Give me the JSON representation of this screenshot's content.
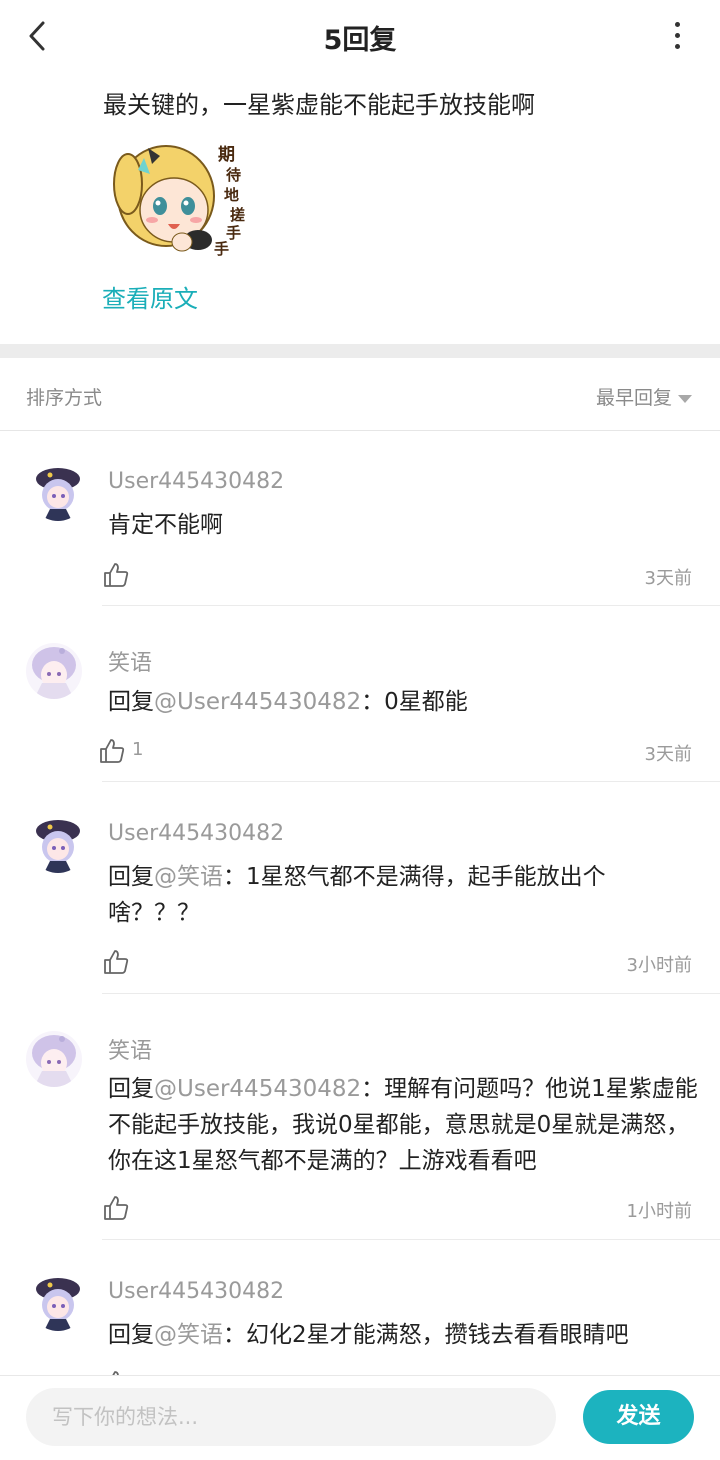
{
  "header": {
    "title": "5回复"
  },
  "post": {
    "text": "最关键的，一星紫虚能不能起手放技能啊",
    "sticker_text": [
      "期",
      "待",
      "地",
      "搓",
      "手",
      "手"
    ],
    "view_original": "查看原文"
  },
  "sort": {
    "label": "排序方式",
    "value": "最早回复"
  },
  "replies": [
    {
      "username": "User445430482",
      "prefix": "",
      "mention": "",
      "text": "肯定不能啊",
      "likes": "",
      "time": "3天前"
    },
    {
      "username": "笑语",
      "prefix": "回复",
      "mention": "@User445430482",
      "text": "：0星都能",
      "likes": "1",
      "time": "3天前"
    },
    {
      "username": "User445430482",
      "prefix": "回复",
      "mention": "@笑语",
      "text": "：1星怒气都不是满得，起手能放出个啥？？？",
      "likes": "",
      "time": "3小时前"
    },
    {
      "username": "笑语",
      "prefix": "回复",
      "mention": "@User445430482",
      "text": "：理解有问题吗？他说1星紫虚能不能起手放技能，我说0星都能，意思就是0星就是满怒，你在这1星怒气都不是满的？上游戏看看吧",
      "likes": "",
      "time": "1小时前"
    },
    {
      "username": "User445430482",
      "prefix": "回复",
      "mention": "@笑语",
      "text": "：幻化2星才能满怒，攒钱去看看眼睛吧",
      "likes": "",
      "time": ""
    }
  ],
  "input": {
    "placeholder": "写下你的想法...",
    "send_label": "发送"
  },
  "colors": {
    "accent": "#1cb3bf",
    "link": "#1aaeb8",
    "muted": "#9a9a9a"
  },
  "icons": {
    "back": "chevron-left-icon",
    "more": "more-vertical-icon",
    "like": "thumbs-up-icon",
    "sort": "triangle-down-icon"
  }
}
